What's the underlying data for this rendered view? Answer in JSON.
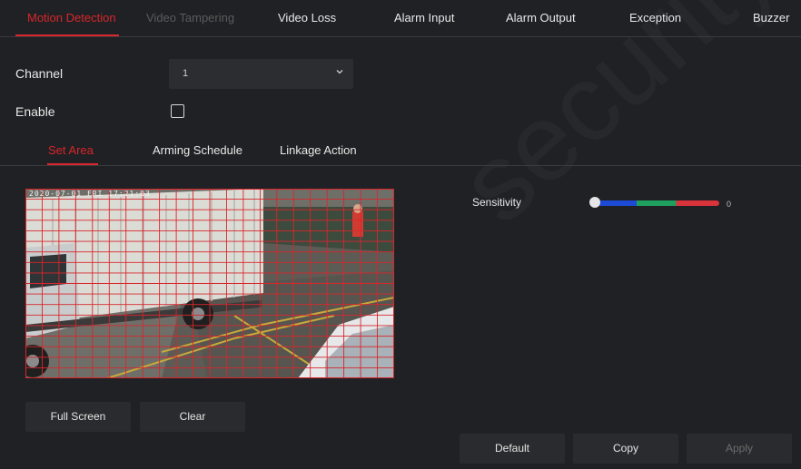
{
  "top_tabs": [
    {
      "label": "Motion Detection",
      "state": "active"
    },
    {
      "label": "Video Tampering",
      "state": "disabled"
    },
    {
      "label": "Video Loss",
      "state": "normal"
    },
    {
      "label": "Alarm Input",
      "state": "normal"
    },
    {
      "label": "Alarm Output",
      "state": "normal"
    },
    {
      "label": "Exception",
      "state": "normal"
    },
    {
      "label": "Buzzer",
      "state": "normal"
    }
  ],
  "channel": {
    "label": "Channel",
    "value": "1"
  },
  "enable": {
    "label": "Enable",
    "checked": false
  },
  "sub_tabs": [
    {
      "label": "Set Area",
      "state": "active"
    },
    {
      "label": "Arming Schedule",
      "state": "normal"
    },
    {
      "label": "Linkage Action",
      "state": "normal"
    }
  ],
  "video": {
    "timestamp": "2020-07-01 FRI 17:21:03"
  },
  "sensitivity": {
    "label": "Sensitivity",
    "value": "0",
    "level": 0
  },
  "area_buttons": {
    "full_screen": "Full Screen",
    "clear": "Clear"
  },
  "footer": {
    "default": "Default",
    "copy": "Copy",
    "apply": "Apply"
  },
  "colors": {
    "accent": "#d8262c",
    "background": "#202124"
  },
  "watermark": "security.com"
}
